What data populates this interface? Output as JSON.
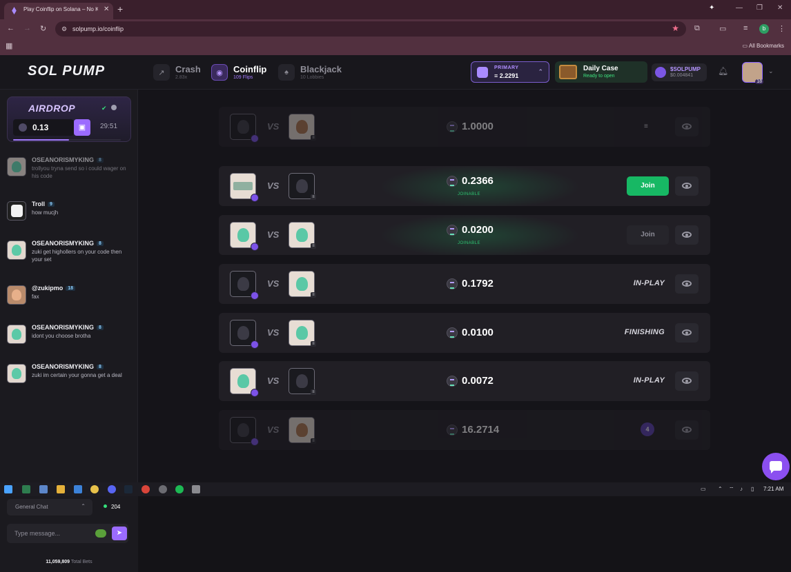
{
  "browser": {
    "tab_title": "Play Coinflip on Solana – No K",
    "url": "solpump.io/coinflip",
    "bookmarks_label": "All Bookmarks",
    "profile_initial": "b"
  },
  "header": {
    "logo": "SOL PUMP",
    "games": [
      {
        "name": "Crash",
        "sub": "2.83x",
        "active": false
      },
      {
        "name": "Coinflip",
        "sub": "109 Flips",
        "active": true
      },
      {
        "name": "Blackjack",
        "sub": "10 Lobbies",
        "active": false
      }
    ],
    "wallet": {
      "label": "PRIMARY",
      "value": "2.2291"
    },
    "daily_case": {
      "title": "Daily Case",
      "sub": "Ready to open"
    },
    "token": {
      "name": "$SOLPUMP",
      "price": "$0.004841"
    },
    "user_level": "18"
  },
  "airdrop": {
    "title": "AIRDROP",
    "amount": "0.13",
    "timer": "29:51",
    "progress": 0.52
  },
  "chat": {
    "messages": [
      {
        "name": "OSEANORISMYKING",
        "level": "8",
        "text": "trollyou tryna send so i could wager on his code",
        "avatar": "mint",
        "faded": true
      },
      {
        "name": "Troll",
        "level": "9",
        "text": "how mucjh",
        "avatar": "dark",
        "faded": false
      },
      {
        "name": "OSEANORISMYKING",
        "level": "8",
        "text": "zuki get highollers on your code then your set",
        "avatar": "mint",
        "faded": false
      },
      {
        "name": "@zukipmo",
        "level": "18",
        "text": "fax",
        "avatar": "orange",
        "faded": false
      },
      {
        "name": "OSEANORISMYKING",
        "level": "8",
        "text": "idont you choose brotha",
        "avatar": "mint",
        "faded": false
      },
      {
        "name": "OSEANORISMYKING",
        "level": "8",
        "text": "zuki im certain your gonna get a deal",
        "avatar": "mint",
        "faded": false
      }
    ],
    "channel": "General Chat",
    "online": "204",
    "input_placeholder": "Type message...",
    "total_bets_value": "11,059,809",
    "total_bets_label": "Total Bets"
  },
  "lobbies": [
    {
      "amount": "1.0000",
      "state": "",
      "join": "",
      "dim": true,
      "joinable": ""
    },
    {
      "amount": "0.2366",
      "state": "",
      "join": "Join",
      "join_active": true,
      "dim": false,
      "joinable": "JOINABLE"
    },
    {
      "amount": "0.0200",
      "state": "",
      "join": "Join",
      "join_active": false,
      "dim": false,
      "joinable": "JOINABLE"
    },
    {
      "amount": "0.1792",
      "state": "IN-PLAY",
      "join": "",
      "dim": false,
      "joinable": ""
    },
    {
      "amount": "0.0100",
      "state": "FINISHING",
      "join": "",
      "dim": false,
      "joinable": ""
    },
    {
      "amount": "0.0072",
      "state": "IN-PLAY",
      "join": "",
      "dim": false,
      "joinable": ""
    },
    {
      "amount": "16.2714",
      "state": "",
      "join": "",
      "dim": true,
      "joinable": "",
      "count": "4"
    }
  ],
  "taskbar": {
    "time": "7:21 AM"
  }
}
